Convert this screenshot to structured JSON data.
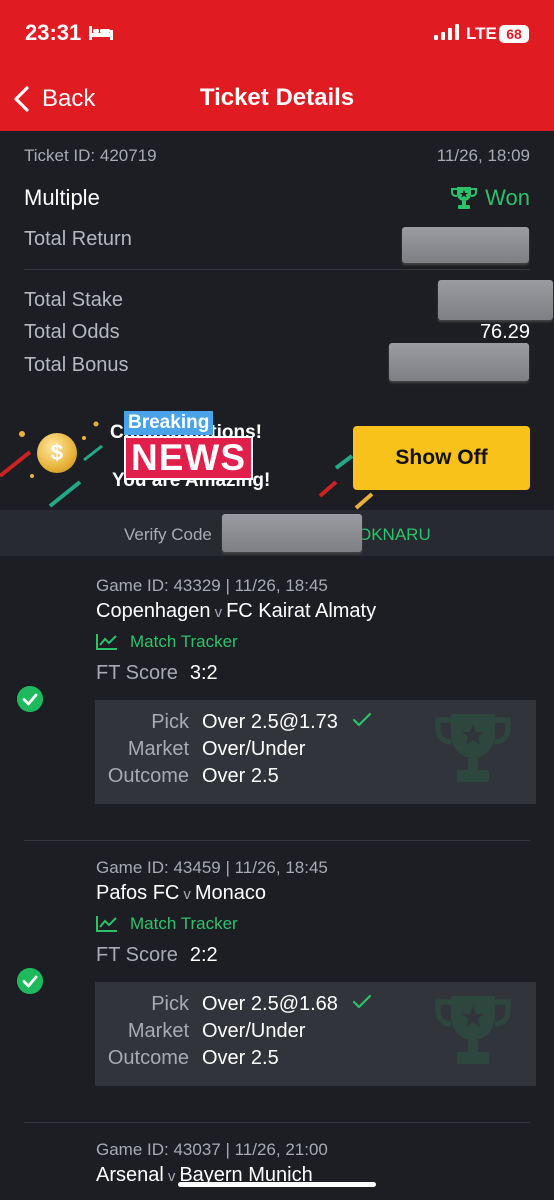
{
  "status": {
    "time": "23:31",
    "network": "LTE",
    "battery": "68"
  },
  "nav": {
    "back_label": "Back",
    "title": "Ticket Details"
  },
  "ticket": {
    "id_label": "Ticket ID: 420719",
    "datetime": "11/26, 18:09",
    "type": "Multiple",
    "status": "Won",
    "total_return_label": "Total Return",
    "total_stake_label": "Total Stake",
    "total_odds_label": "Total Odds",
    "total_odds_value": "76.29",
    "total_bonus_label": "Total Bonus"
  },
  "promo": {
    "congrats_text": "Congratulations!",
    "amazing_text": "You are Amazing!",
    "breaking": "Breaking",
    "news": "NEWS",
    "coin_symbol": "$",
    "show_off_label": "Show Off"
  },
  "verify": {
    "label": "Verify Code",
    "code_visible_suffix": "OKNARU"
  },
  "games": [
    {
      "id_line": "Game ID: 43329 | 11/26, 18:45",
      "home": "Copenhagen",
      "vs": "v",
      "away": "FC Kairat Almaty",
      "tracker": "Match Tracker",
      "ft_label": "FT Score",
      "ft_score": "3:2",
      "pick_label": "Pick",
      "pick": "Over 2.5@1.73",
      "market_label": "Market",
      "market": "Over/Under",
      "outcome_label": "Outcome",
      "outcome": "Over 2.5"
    },
    {
      "id_line": "Game ID: 43459 | 11/26, 18:45",
      "home": "Pafos FC",
      "vs": "v",
      "away": "Monaco",
      "tracker": "Match Tracker",
      "ft_label": "FT Score",
      "ft_score": "2:2",
      "pick_label": "Pick",
      "pick": "Over 2.5@1.68",
      "market_label": "Market",
      "market": "Over/Under",
      "outcome_label": "Outcome",
      "outcome": "Over 2.5"
    },
    {
      "id_line": "Game ID: 43037 | 11/26, 21:00",
      "home": "Arsenal",
      "vs": "v",
      "away": "Bayern Munich"
    }
  ],
  "colors": {
    "header_red": "#e01b22",
    "won_green": "#2ec16a",
    "show_off_yellow": "#f8c21a",
    "background": "#1c1e24"
  }
}
